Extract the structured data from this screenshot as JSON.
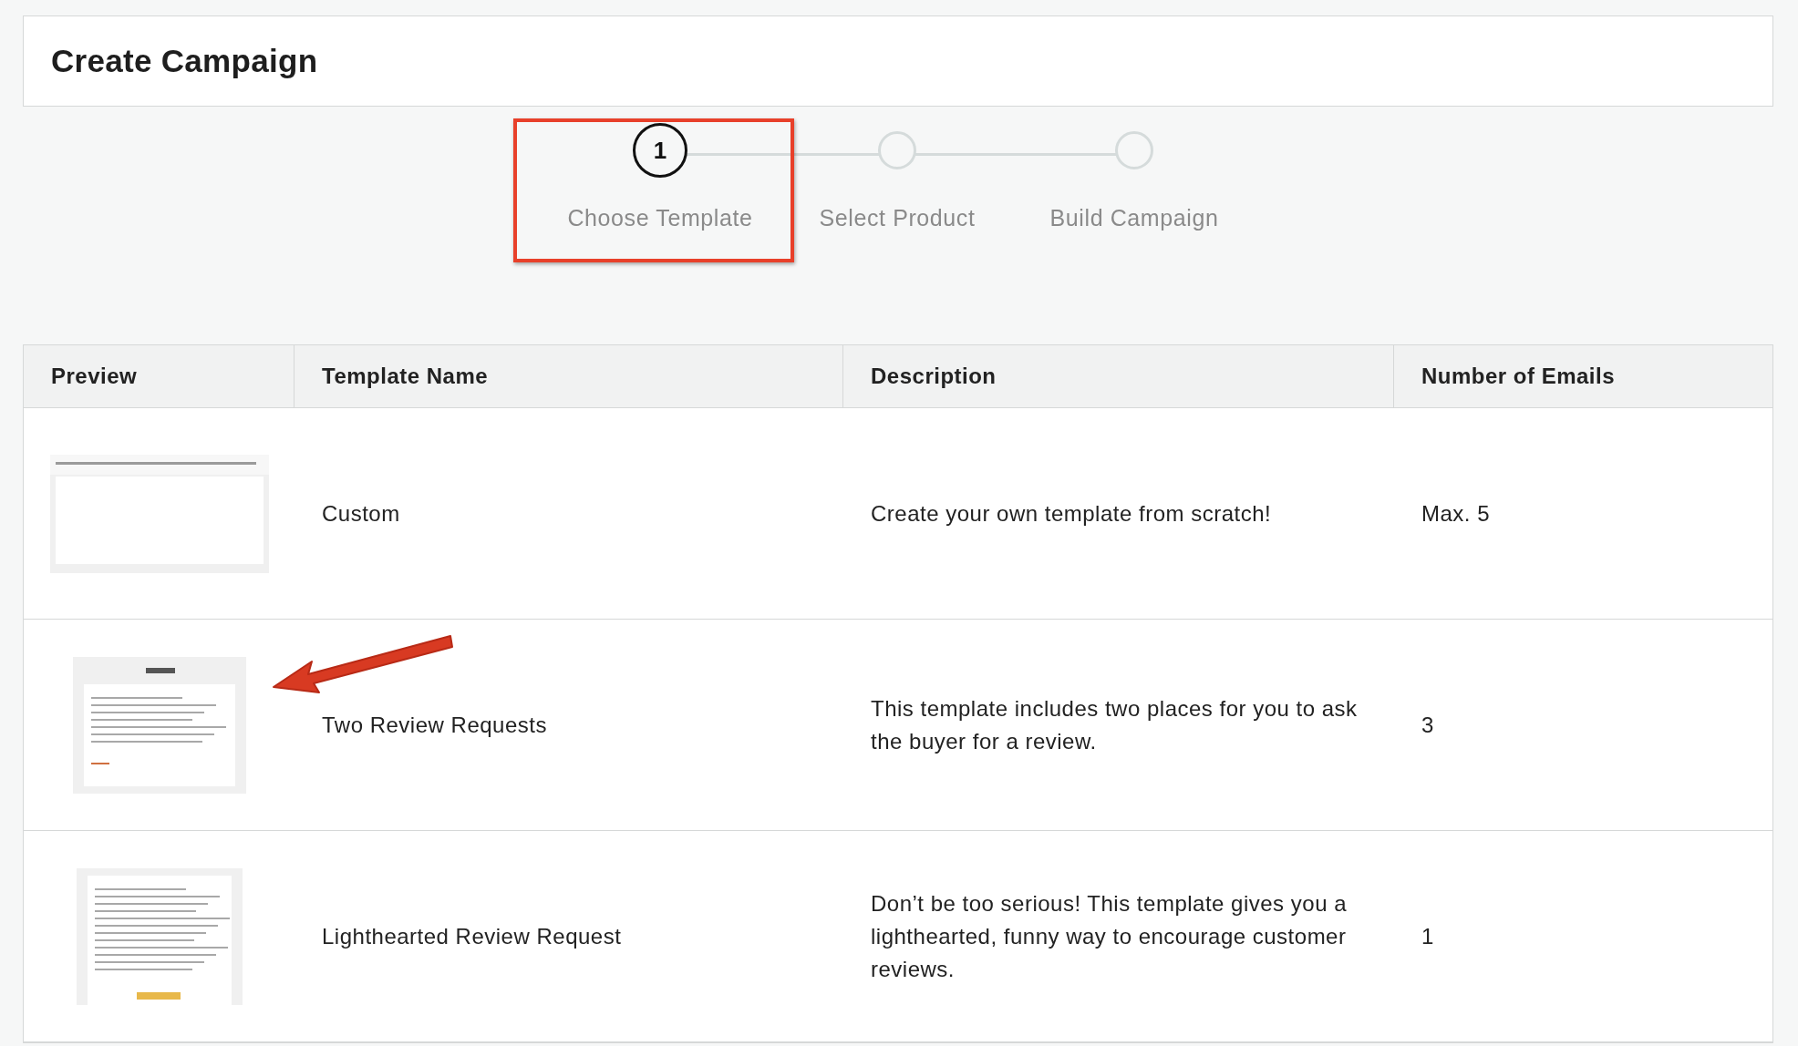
{
  "page": {
    "title": "Create Campaign"
  },
  "steps": [
    {
      "number": "1",
      "label": "Choose Template",
      "selected": true
    },
    {
      "label": "Select Product",
      "selected": false
    },
    {
      "label": "Build Campaign",
      "selected": false
    }
  ],
  "table": {
    "columns": [
      "Preview",
      "Template Name",
      "Description",
      "Number of Emails"
    ],
    "rows": [
      {
        "name": "Custom",
        "description": "Create your own template from scratch!",
        "emails": "Max. 5"
      },
      {
        "name": "Two Review Requests",
        "description": "This template includes two places for you to ask the buyer for a review.",
        "emails": "3"
      },
      {
        "name": "Lighthearted Review Request",
        "description": "Don’t be too serious! This template gives you a lighthearted, funny way to encourage customer reviews.",
        "emails": "1"
      }
    ]
  }
}
